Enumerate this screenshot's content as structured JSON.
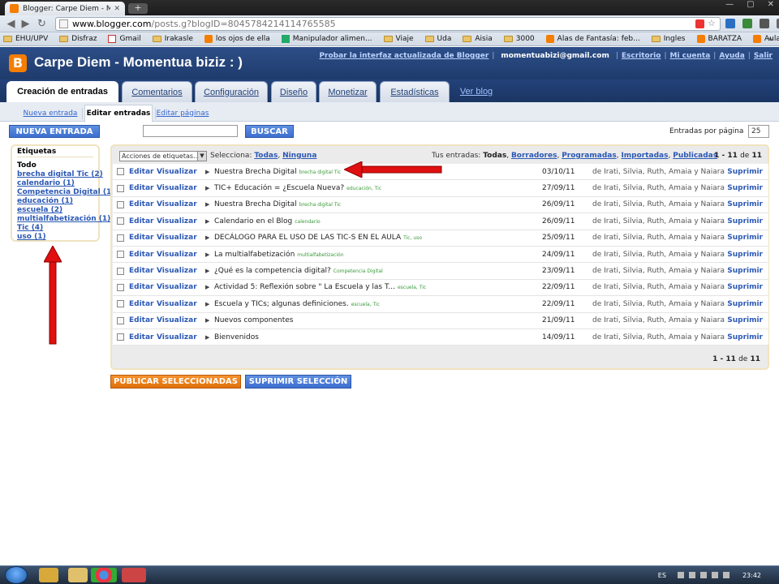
{
  "browser": {
    "tab_title": "Blogger: Carpe Diem - Mom",
    "url_host": "www.blogger.com",
    "url_path": "/posts.g?blogID=8045784214114765585",
    "bookmarks": [
      "EHU/UPV",
      "Disfraz",
      "Gmail",
      "Irakasle",
      "los ojos de ella",
      "Manipulador alimen...",
      "Viaje",
      "Uda",
      "Aisia",
      "3000",
      "Alas de Fantasía: feb...",
      "Ingles",
      "BARATZA",
      "Aula de violín; Do,re..."
    ],
    "bookmarks_more": "»"
  },
  "header": {
    "blog_title": "Carpe Diem - Momentua biziz : )",
    "try_new": "Probar la interfaz actualizada de Blogger",
    "email": "momentuabizi@gmail.com",
    "links": [
      "Escritorio",
      "Mi cuenta",
      "Ayuda",
      "Salir"
    ]
  },
  "tabs": {
    "create": "Creación de entradas",
    "comments": "Comentarios",
    "config": "Configuración",
    "design": "Diseño",
    "monetize": "Monetizar",
    "stats": "Estadísticas",
    "view_blog": "Ver blog"
  },
  "subtabs": {
    "new_post": "Nueva entrada",
    "edit_posts": "Editar entradas",
    "edit_pages": "Editar páginas"
  },
  "controls": {
    "new_post_btn": "NUEVA ENTRADA",
    "search_btn": "BUSCAR",
    "per_page_label": "Entradas por página",
    "per_page_value": "25"
  },
  "labels": {
    "heading": "Etiquetas",
    "all": "Todo",
    "items": [
      "brecha digital Tic (2)",
      "calendario (1)",
      "Competencia Digital (1)",
      "educación (1)",
      "escuela (2)",
      "multialfabetización (1)",
      "Tic (4)",
      "uso (1)"
    ]
  },
  "toolbar": {
    "actions": "Acciones de etiquetas...",
    "select_label": "Selecciona:",
    "select_all": "Todas",
    "select_none": "Ninguna",
    "yours_label": "Tus entradas:",
    "yours_all": "Todas",
    "drafts": "Borradores",
    "scheduled": "Programadas",
    "imported": "Importadas",
    "published": "Publicadas",
    "count_pre": "1",
    "count_dash": "-",
    "count_end": "11",
    "count_of": "de",
    "count_total": "11"
  },
  "posts": [
    {
      "edit": "Editar",
      "view": "Visualizar",
      "title": "Nuestra Brecha Digital",
      "tags": "brecha digital Tic",
      "date": "03/10/11",
      "author": "de Irati, Silvia, Ruth, Amaia y Naiara",
      "delete": "Suprimir"
    },
    {
      "edit": "Editar",
      "view": "Visualizar",
      "title": "TIC+ Educación = ¿Escuela Nueva?",
      "tags": "educación, Tic",
      "date": "27/09/11",
      "author": "de Irati, Silvia, Ruth, Amaia y Naiara",
      "delete": "Suprimir"
    },
    {
      "edit": "Editar",
      "view": "Visualizar",
      "title": "Nuestra Brecha Digital",
      "tags": "brecha digital Tic",
      "date": "26/09/11",
      "author": "de Irati, Silvia, Ruth, Amaia y Naiara",
      "delete": "Suprimir"
    },
    {
      "edit": "Editar",
      "view": "Visualizar",
      "title": "Calendario en el Blog",
      "tags": "calendario",
      "date": "26/09/11",
      "author": "de Irati, Silvia, Ruth, Amaia y Naiara",
      "delete": "Suprimir"
    },
    {
      "edit": "Editar",
      "view": "Visualizar",
      "title": "DECÁLOGO PARA EL USO DE LAS TIC-S EN EL AULA",
      "tags": "Tic, uso",
      "date": "25/09/11",
      "author": "de Irati, Silvia, Ruth, Amaia y Naiara",
      "delete": "Suprimir"
    },
    {
      "edit": "Editar",
      "view": "Visualizar",
      "title": "La multialfabetización",
      "tags": "multialfabetización",
      "date": "24/09/11",
      "author": "de Irati, Silvia, Ruth, Amaia y Naiara",
      "delete": "Suprimir"
    },
    {
      "edit": "Editar",
      "view": "Visualizar",
      "title": "¿Qué es la competencia digital?",
      "tags": "Competencia Digital",
      "date": "23/09/11",
      "author": "de Irati, Silvia, Ruth, Amaia y Naiara",
      "delete": "Suprimir"
    },
    {
      "edit": "Editar",
      "view": "Visualizar",
      "title": "Actividad 5: Reflexión sobre \" La Escuela y las T...",
      "tags": "escuela, Tic",
      "date": "22/09/11",
      "author": "de Irati, Silvia, Ruth, Amaia y Naiara",
      "delete": "Suprimir"
    },
    {
      "edit": "Editar",
      "view": "Visualizar",
      "title": "Escuela y TICs; algunas definiciones.",
      "tags": "escuela, Tic",
      "date": "22/09/11",
      "author": "de Irati, Silvia, Ruth, Amaia y Naiara",
      "delete": "Suprimir"
    },
    {
      "edit": "Editar",
      "view": "Visualizar",
      "title": "Nuevos componentes",
      "tags": "",
      "date": "21/09/11",
      "author": "de Irati, Silvia, Ruth, Amaia y Naiara",
      "delete": "Suprimir"
    },
    {
      "edit": "Editar",
      "view": "Visualizar",
      "title": "Bienvenidos",
      "tags": "",
      "date": "14/09/11",
      "author": "de Irati, Silvia, Ruth, Amaia y Naiara",
      "delete": "Suprimir"
    }
  ],
  "bottom": {
    "publish_btn": "PUBLICAR SELECCIONADAS",
    "delete_btn": "SUPRIMIR SELECCIÓN"
  },
  "taskbar": {
    "lang": "ES",
    "clock": "23:42"
  },
  "colors": {
    "blogger_orange": "#f57d00",
    "header_blue": "#23427a",
    "link_blue": "#2b58b5",
    "tag_green": "#3a9a3a",
    "annotation_red": "#e01010"
  }
}
